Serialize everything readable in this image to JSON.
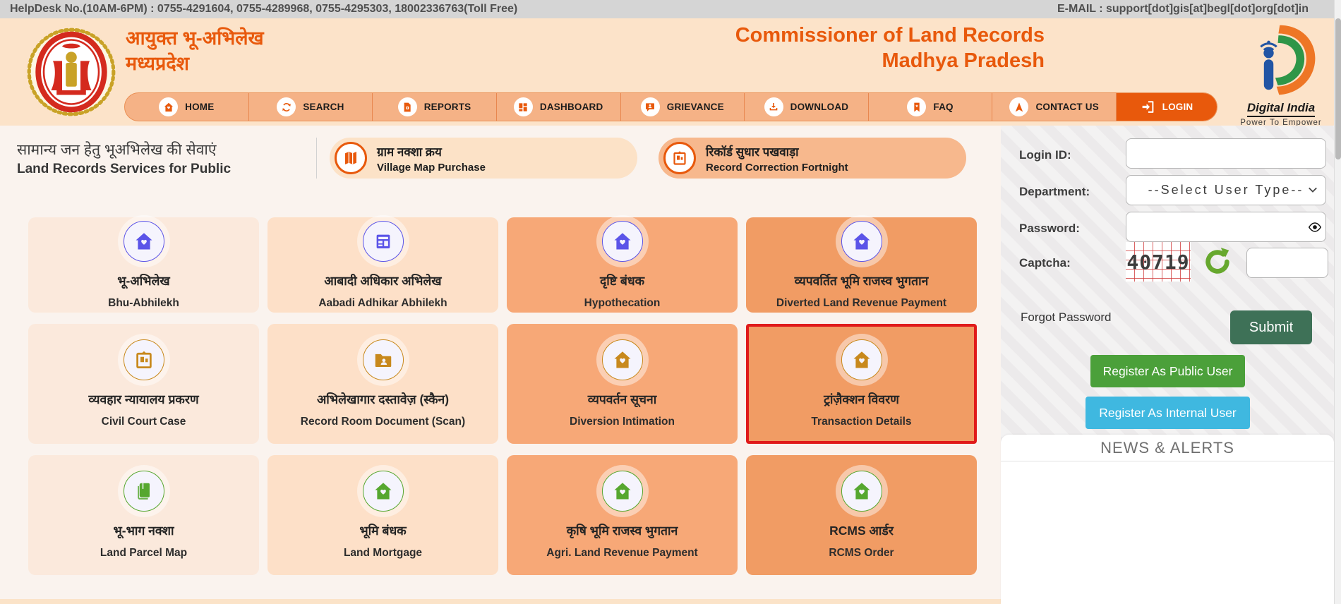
{
  "topbar": {
    "helpdesk": "HelpDesk No.(10AM-6PM) : 0755-4291604, 0755-4289968, 0755-4295303, 18002336763(Toll Free)",
    "email": "E-MAIL : support[dot]gis[at]begl[dot]org[dot]in"
  },
  "header": {
    "title_hi_line1": "आयुक्त भू-अभिलेख",
    "title_hi_line2": "मध्यप्रदेश",
    "title_en_line1": "Commissioner of Land Records",
    "title_en_line2": "Madhya Pradesh",
    "digital_india_line1": "Digital India",
    "digital_india_line2": "Power To Empower"
  },
  "nav": {
    "items": [
      {
        "label": "HOME",
        "icon": "home-icon"
      },
      {
        "label": "SEARCH",
        "icon": "sync-icon"
      },
      {
        "label": "REPORTS",
        "icon": "report-icon"
      },
      {
        "label": "DASHBOARD",
        "icon": "dashboard-icon"
      },
      {
        "label": "GRIEVANCE",
        "icon": "grievance-icon"
      },
      {
        "label": "DOWNLOAD",
        "icon": "download-icon"
      },
      {
        "label": "FAQ",
        "icon": "faq-icon"
      },
      {
        "label": "CONTACT US",
        "icon": "contact-icon"
      },
      {
        "label": "LOGIN",
        "icon": "login-icon"
      }
    ]
  },
  "services": {
    "heading_hi": "सामान्य जन हेतु भूअभिलेख की सेवाएं",
    "heading_en": "Land Records Services for Public",
    "banners": [
      {
        "hi": "ग्राम नक्शा क्रय",
        "en": "Village Map Purchase",
        "icon": "map-icon"
      },
      {
        "hi": "रिकॉर्ड सुधार पखवाड़ा",
        "en": "Record Correction Fortnight",
        "icon": "frame-icon"
      }
    ],
    "cards": [
      {
        "hi": "भू-अभिलेख",
        "en": "Bhu-Abhilekh",
        "icon": "home-icon"
      },
      {
        "hi": "आबादी अधिकार अभिलेख",
        "en": "Aabadi Adhikar Abhilekh",
        "icon": "ledger-icon"
      },
      {
        "hi": "दृष्टि बंधक",
        "en": "Hypothecation",
        "icon": "home-icon"
      },
      {
        "hi": "व्यपवर्तित भूमि राजस्व भुगतान",
        "en": "Diverted Land Revenue Payment",
        "icon": "home-icon"
      },
      {
        "hi": "व्यवहार न्यायालय प्रकरण",
        "en": "Civil Court Case",
        "icon": "frame-icon"
      },
      {
        "hi": "अभिलेखागार दस्तावेज़ (स्कैन)",
        "en": "Record Room Document (Scan)",
        "icon": "folder-icon"
      },
      {
        "hi": "व्यपवर्तन सूचना",
        "en": "Diversion Intimation",
        "icon": "home-icon"
      },
      {
        "hi": "ट्रांज़ैक्शन विवरण",
        "en": "Transaction Details",
        "icon": "home-icon"
      },
      {
        "hi": "भू-भाग नक्शा",
        "en": "Land Parcel Map",
        "icon": "book-icon"
      },
      {
        "hi": "भूमि बंधक",
        "en": "Land Mortgage",
        "icon": "home-icon"
      },
      {
        "hi": "कृषि भूमि राजस्व भुगतान",
        "en": "Agri. Land Revenue Payment",
        "icon": "home-icon"
      },
      {
        "hi": "RCMS आर्डर",
        "en": "RCMS Order",
        "icon": "home-icon"
      }
    ]
  },
  "login_panel": {
    "login_id_label": "Login ID:",
    "department_label": "Department:",
    "password_label": "Password:",
    "captcha_label": "Captcha:",
    "select_value": "--Select User Type--",
    "captcha_value": "40719",
    "forgot_label": "Forgot Password",
    "submit_label": "Submit",
    "register_public_label": "Register As Public User",
    "register_internal_label": "Register As Internal User"
  },
  "news": {
    "title": "NEWS & ALERTS"
  },
  "colors": {
    "accent_orange": "#e8590c",
    "nav_bg": "#f5b286",
    "header_bg": "#fce3c9",
    "card_light_a": "#fbe9dc",
    "card_light_b": "#fde0c8",
    "card_orange": "#f7a877",
    "card_orange_dark": "#f19c64",
    "highlight_red": "#e01b1b",
    "icon_purple": "#5b54e8",
    "icon_amber": "#c8891d",
    "icon_green": "#56a72f",
    "submit_green": "#3e7157",
    "register_green": "#4ba03a",
    "register_blue": "#3fb8e0"
  }
}
